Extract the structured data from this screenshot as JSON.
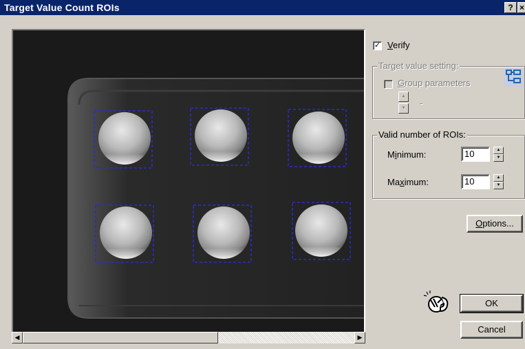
{
  "window": {
    "title": "Target Value Count ROIs",
    "help_button": "?",
    "close_button": "×"
  },
  "verify": {
    "label": "Verify",
    "checked": true
  },
  "target_group": {
    "title": "Target value setting:",
    "group_params_label": "Group parameters",
    "group_params_checked": false,
    "dash": "-"
  },
  "valid_rois": {
    "title": "Valid number of ROIs:",
    "minimum_label": "Minimum:",
    "minimum_value": "10",
    "maximum_label": "Maximum:",
    "maximum_value": "10"
  },
  "buttons": {
    "options": "Options...",
    "ok": "OK",
    "cancel": "Cancel"
  },
  "icons": {
    "tree": "tree-structure-icon",
    "teach": "teach-hand-icon"
  },
  "colors": {
    "titlebar": "#0a246a",
    "roi_outline": "#1a1acc",
    "face": "#d4d0c8"
  }
}
